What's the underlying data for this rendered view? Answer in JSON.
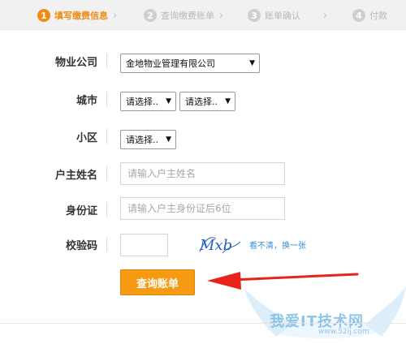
{
  "steps": [
    {
      "num": "1",
      "label": "填写缴费信息"
    },
    {
      "num": "2",
      "label": "查询缴费账单"
    },
    {
      "num": "3",
      "label": "账单确认"
    },
    {
      "num": "4",
      "label": "付款"
    }
  ],
  "chevron": "›",
  "form": {
    "property_company": {
      "label": "物业公司",
      "value": "金地物业管理有限公司"
    },
    "city": {
      "label": "城市",
      "select1": "请选择..",
      "select2": "请选择.."
    },
    "community": {
      "label": "小区",
      "value": "请选择.."
    },
    "owner_name": {
      "label": "户主姓名",
      "placeholder": "请输入户主姓名"
    },
    "id_card": {
      "label": "身份证",
      "placeholder": "请输入户主身份证后6位"
    },
    "captcha": {
      "label": "校验码",
      "image_text": "Mxb",
      "refresh_text": "看不清，换一张"
    }
  },
  "submit_label": "查询账单",
  "watermark": {
    "text": "我爱IT技术网",
    "url": "www.52ij.com"
  },
  "colors": {
    "accent": "#f08c12",
    "button": "#f59a12",
    "arrow": "#e8231c",
    "link": "#3a8fd8"
  }
}
